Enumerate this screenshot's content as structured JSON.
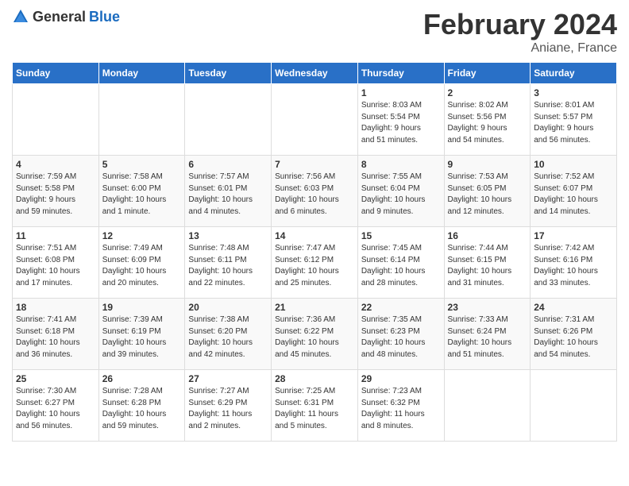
{
  "header": {
    "logo_general": "General",
    "logo_blue": "Blue",
    "month_year": "February 2024",
    "location": "Aniane, France"
  },
  "weekdays": [
    "Sunday",
    "Monday",
    "Tuesday",
    "Wednesday",
    "Thursday",
    "Friday",
    "Saturday"
  ],
  "weeks": [
    [
      {
        "day": "",
        "info": ""
      },
      {
        "day": "",
        "info": ""
      },
      {
        "day": "",
        "info": ""
      },
      {
        "day": "",
        "info": ""
      },
      {
        "day": "1",
        "info": "Sunrise: 8:03 AM\nSunset: 5:54 PM\nDaylight: 9 hours\nand 51 minutes."
      },
      {
        "day": "2",
        "info": "Sunrise: 8:02 AM\nSunset: 5:56 PM\nDaylight: 9 hours\nand 54 minutes."
      },
      {
        "day": "3",
        "info": "Sunrise: 8:01 AM\nSunset: 5:57 PM\nDaylight: 9 hours\nand 56 minutes."
      }
    ],
    [
      {
        "day": "4",
        "info": "Sunrise: 7:59 AM\nSunset: 5:58 PM\nDaylight: 9 hours\nand 59 minutes."
      },
      {
        "day": "5",
        "info": "Sunrise: 7:58 AM\nSunset: 6:00 PM\nDaylight: 10 hours\nand 1 minute."
      },
      {
        "day": "6",
        "info": "Sunrise: 7:57 AM\nSunset: 6:01 PM\nDaylight: 10 hours\nand 4 minutes."
      },
      {
        "day": "7",
        "info": "Sunrise: 7:56 AM\nSunset: 6:03 PM\nDaylight: 10 hours\nand 6 minutes."
      },
      {
        "day": "8",
        "info": "Sunrise: 7:55 AM\nSunset: 6:04 PM\nDaylight: 10 hours\nand 9 minutes."
      },
      {
        "day": "9",
        "info": "Sunrise: 7:53 AM\nSunset: 6:05 PM\nDaylight: 10 hours\nand 12 minutes."
      },
      {
        "day": "10",
        "info": "Sunrise: 7:52 AM\nSunset: 6:07 PM\nDaylight: 10 hours\nand 14 minutes."
      }
    ],
    [
      {
        "day": "11",
        "info": "Sunrise: 7:51 AM\nSunset: 6:08 PM\nDaylight: 10 hours\nand 17 minutes."
      },
      {
        "day": "12",
        "info": "Sunrise: 7:49 AM\nSunset: 6:09 PM\nDaylight: 10 hours\nand 20 minutes."
      },
      {
        "day": "13",
        "info": "Sunrise: 7:48 AM\nSunset: 6:11 PM\nDaylight: 10 hours\nand 22 minutes."
      },
      {
        "day": "14",
        "info": "Sunrise: 7:47 AM\nSunset: 6:12 PM\nDaylight: 10 hours\nand 25 minutes."
      },
      {
        "day": "15",
        "info": "Sunrise: 7:45 AM\nSunset: 6:14 PM\nDaylight: 10 hours\nand 28 minutes."
      },
      {
        "day": "16",
        "info": "Sunrise: 7:44 AM\nSunset: 6:15 PM\nDaylight: 10 hours\nand 31 minutes."
      },
      {
        "day": "17",
        "info": "Sunrise: 7:42 AM\nSunset: 6:16 PM\nDaylight: 10 hours\nand 33 minutes."
      }
    ],
    [
      {
        "day": "18",
        "info": "Sunrise: 7:41 AM\nSunset: 6:18 PM\nDaylight: 10 hours\nand 36 minutes."
      },
      {
        "day": "19",
        "info": "Sunrise: 7:39 AM\nSunset: 6:19 PM\nDaylight: 10 hours\nand 39 minutes."
      },
      {
        "day": "20",
        "info": "Sunrise: 7:38 AM\nSunset: 6:20 PM\nDaylight: 10 hours\nand 42 minutes."
      },
      {
        "day": "21",
        "info": "Sunrise: 7:36 AM\nSunset: 6:22 PM\nDaylight: 10 hours\nand 45 minutes."
      },
      {
        "day": "22",
        "info": "Sunrise: 7:35 AM\nSunset: 6:23 PM\nDaylight: 10 hours\nand 48 minutes."
      },
      {
        "day": "23",
        "info": "Sunrise: 7:33 AM\nSunset: 6:24 PM\nDaylight: 10 hours\nand 51 minutes."
      },
      {
        "day": "24",
        "info": "Sunrise: 7:31 AM\nSunset: 6:26 PM\nDaylight: 10 hours\nand 54 minutes."
      }
    ],
    [
      {
        "day": "25",
        "info": "Sunrise: 7:30 AM\nSunset: 6:27 PM\nDaylight: 10 hours\nand 56 minutes."
      },
      {
        "day": "26",
        "info": "Sunrise: 7:28 AM\nSunset: 6:28 PM\nDaylight: 10 hours\nand 59 minutes."
      },
      {
        "day": "27",
        "info": "Sunrise: 7:27 AM\nSunset: 6:29 PM\nDaylight: 11 hours\nand 2 minutes."
      },
      {
        "day": "28",
        "info": "Sunrise: 7:25 AM\nSunset: 6:31 PM\nDaylight: 11 hours\nand 5 minutes."
      },
      {
        "day": "29",
        "info": "Sunrise: 7:23 AM\nSunset: 6:32 PM\nDaylight: 11 hours\nand 8 minutes."
      },
      {
        "day": "",
        "info": ""
      },
      {
        "day": "",
        "info": ""
      }
    ]
  ]
}
